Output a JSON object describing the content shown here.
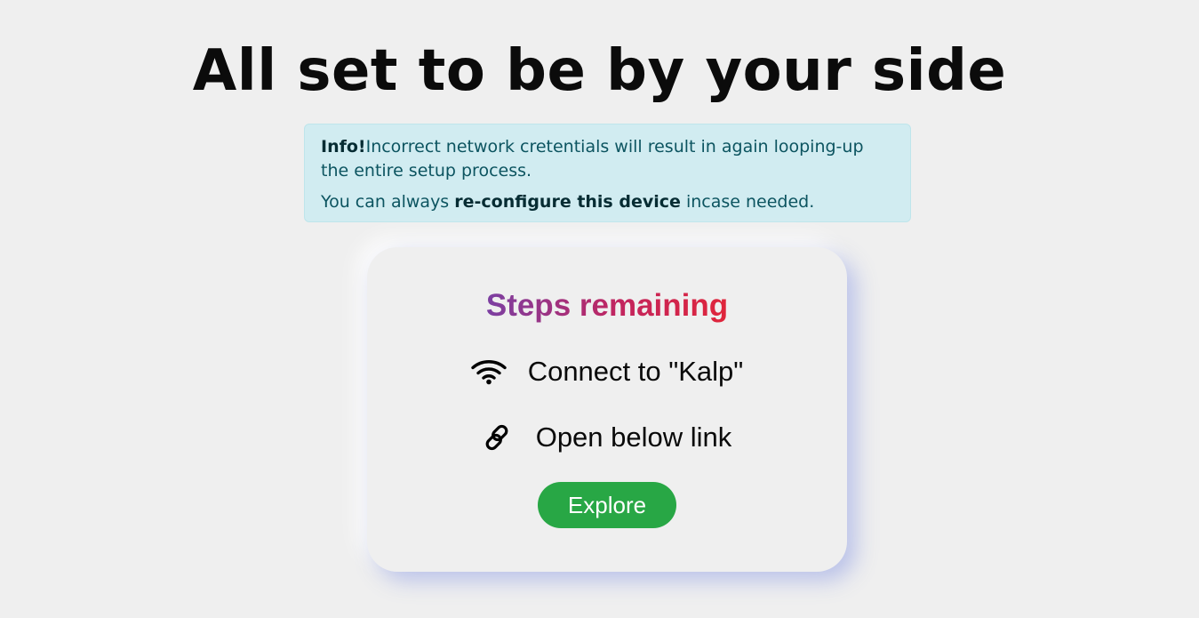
{
  "page": {
    "title": "All set to be by your side"
  },
  "alert": {
    "label": "Info!",
    "line1_text": "Incorrect network cretentials will result in again looping-up the entire setup process.",
    "line2_prefix": "You can always ",
    "line2_bold": "re-configure this device",
    "line2_suffix": " incase needed.",
    "colors": {
      "background": "#d1ecf1",
      "border": "#bee5eb",
      "text": "#0c5460"
    }
  },
  "card": {
    "heading": "Steps remaining",
    "heading_gradient": [
      "#7b3fa2",
      "#c2255f",
      "#e0253a"
    ],
    "steps": [
      {
        "icon": "wifi-icon",
        "text": "Connect to \"Kalp\""
      },
      {
        "icon": "link-icon",
        "text": "Open below link"
      }
    ],
    "button": {
      "label": "Explore",
      "color": "#28a745"
    }
  }
}
